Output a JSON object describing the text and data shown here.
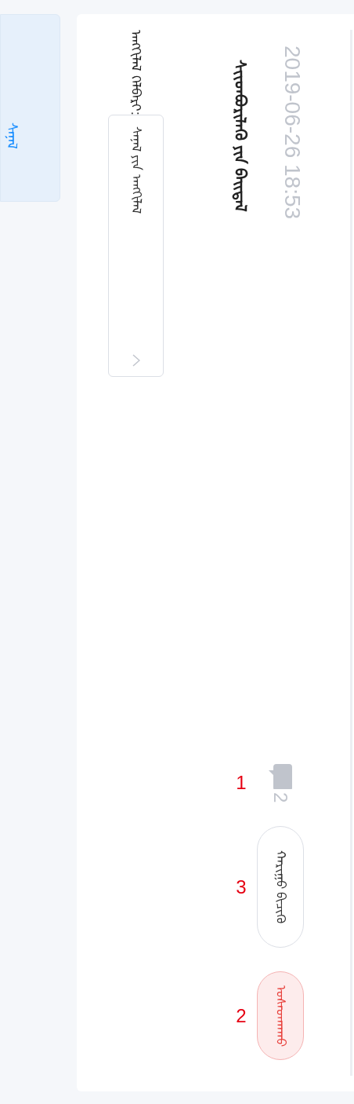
{
  "sidebar": {
    "tabs": [
      {
        "label": "ᠰᠠᠨᠠᠯ",
        "selected": true
      }
    ]
  },
  "card": {
    "time": "2019-06-26 18:53",
    "title": "ᠰᠢᠢᠳᠪᠦᠷᠢᠯᠡᠬᠦ ᠶᠢᠨ ᠪᠠᠢᠳᠠᠯ",
    "field_label": "ᠠᠩᠭᠢᠯᠠᠯ ᠬᠡᠯᠪᠡᠷᠢ",
    "field_separator": ":",
    "field_value": "ᠰᠠᠨᠠᠯ ᠶᠢᠨ ᠠᠩᠭᠢᠯᠠᠯ",
    "comments": {
      "count": "2",
      "annotation": "1"
    },
    "actions": [
      {
        "label": "ᠬᠠᠷᠢᠭᠤ ᠪᠢᠴᠢᠬᠦ",
        "kind": "default",
        "annotation": "3"
      },
      {
        "label": "ᠤᠰᠠᠳᠬᠠᠬᠤ",
        "kind": "danger",
        "annotation": "2"
      }
    ]
  }
}
